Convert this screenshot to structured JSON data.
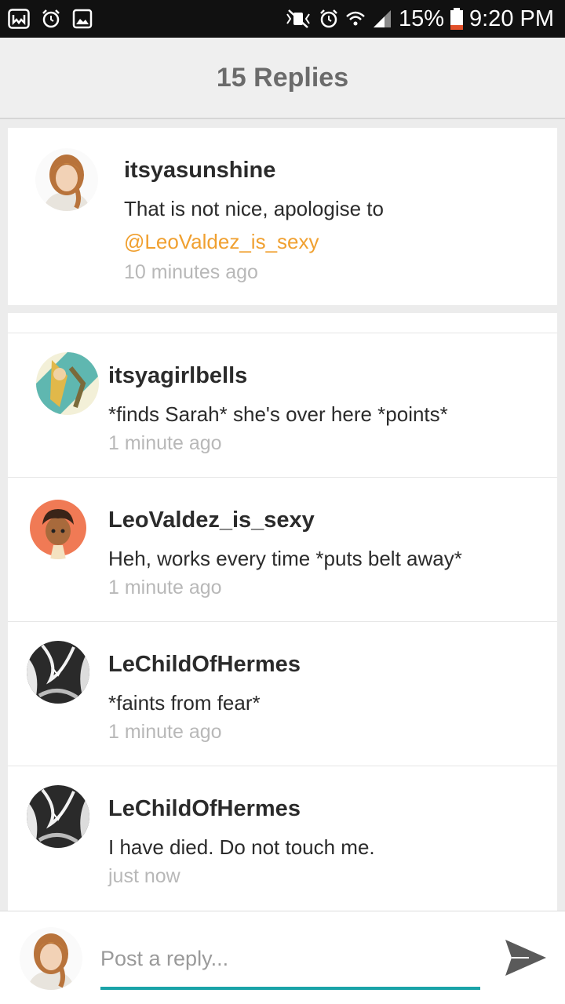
{
  "status_bar": {
    "left_icons": [
      "app-icon",
      "alarm-icon",
      "image-icon"
    ],
    "right_icons": [
      "mute-icon",
      "alarm-icon",
      "wifi-icon",
      "signal-icon"
    ],
    "battery": "15%",
    "time": "9:20 PM"
  },
  "header": {
    "title": "15 Replies"
  },
  "parent_comment": {
    "username": "itsyasunshine",
    "text": "That is not nice, apologise to",
    "mention": "@LeoValdez_is_sexy",
    "time": "10 minutes ago"
  },
  "replies": [
    {
      "username": "itsyagirlbells",
      "text": "*finds Sarah* she's over here *points*",
      "time": "1 minute ago"
    },
    {
      "username": "LeoValdez_is_sexy",
      "text": "Heh, works every time *puts belt away*",
      "time": "1 minute ago"
    },
    {
      "username": "LeChildOfHermes",
      "text": "*faints from fear*",
      "time": "1 minute ago"
    },
    {
      "username": "LeChildOfHermes",
      "text": "I have died. Do not touch me.",
      "time": "just now"
    }
  ],
  "composer": {
    "placeholder": "Post a reply..."
  },
  "colors": {
    "mention": "#f0a030",
    "accent": "#1aa3a8"
  }
}
